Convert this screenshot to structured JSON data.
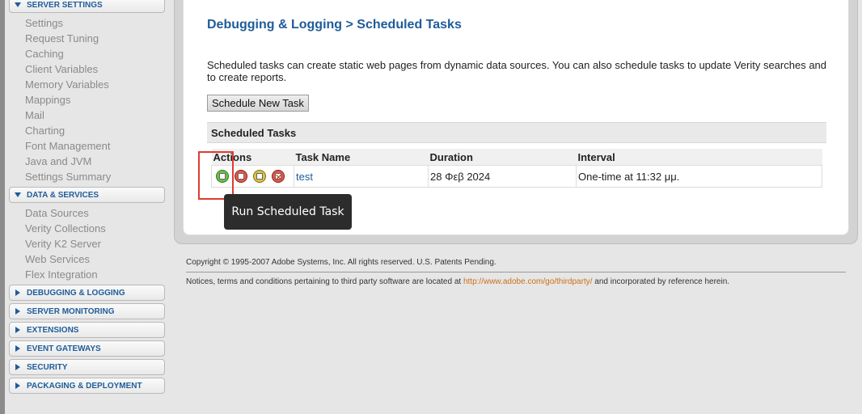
{
  "sidebar": {
    "sections": [
      {
        "label": "SERVER SETTINGS",
        "expanded": true,
        "items": [
          "Settings",
          "Request Tuning",
          "Caching",
          "Client Variables",
          "Memory Variables",
          "Mappings",
          "Mail",
          "Charting",
          "Font Management",
          "Java and JVM",
          "Settings Summary"
        ]
      },
      {
        "label": "DATA & SERVICES",
        "expanded": true,
        "items": [
          "Data Sources",
          "Verity Collections",
          "Verity K2 Server",
          "Web Services",
          "Flex Integration"
        ]
      },
      {
        "label": "DEBUGGING & LOGGING",
        "expanded": false,
        "items": []
      },
      {
        "label": "SERVER MONITORING",
        "expanded": false,
        "items": []
      },
      {
        "label": "EXTENSIONS",
        "expanded": false,
        "items": []
      },
      {
        "label": "EVENT GATEWAYS",
        "expanded": false,
        "items": []
      },
      {
        "label": "SECURITY",
        "expanded": false,
        "items": []
      },
      {
        "label": "PACKAGING & DEPLOYMENT",
        "expanded": false,
        "items": []
      }
    ]
  },
  "main": {
    "title": "Debugging & Logging > Scheduled Tasks",
    "description": "Scheduled tasks can create static web pages from dynamic data sources. You can also schedule tasks to update Verity searches and to create reports.",
    "schedule_button": "Schedule New Task",
    "tasks_header": "Scheduled Tasks",
    "columns": [
      "Actions",
      "Task Name",
      "Duration",
      "Interval"
    ],
    "rows": [
      {
        "task_name": "test",
        "duration": "28 Φεβ 2024",
        "interval": "One-time at 11:32 μμ.",
        "actions": [
          "run-icon",
          "pause-icon",
          "edit-icon",
          "delete-icon"
        ]
      }
    ],
    "tooltip": "Run Scheduled Task"
  },
  "footer": {
    "copyright": "Copyright © 1995-2007 Adobe Systems, Inc. All rights reserved. U.S. Patents Pending.",
    "notice_prefix": "Notices, terms and conditions pertaining to third party software are located at",
    "notice_link": "http://www.adobe.com/go/thirdparty/",
    "notice_suffix": "and incorporated by reference herein."
  },
  "colors": {
    "accent": "#1f5c99",
    "link_orange": "#c9701a",
    "highlight": "#e23a2e"
  }
}
